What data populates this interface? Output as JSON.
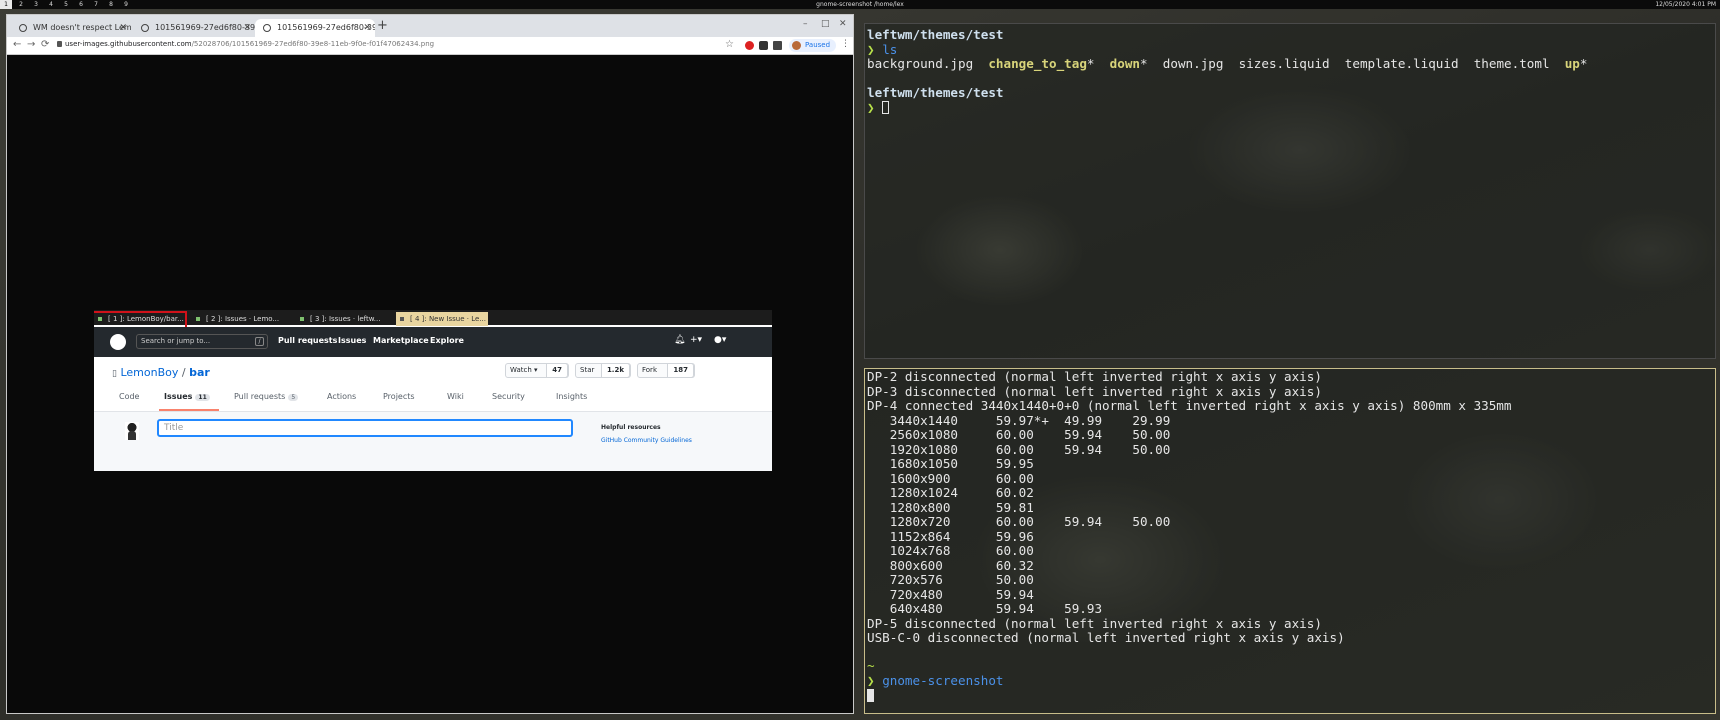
{
  "topbar": {
    "workspaces": [
      "1",
      "2",
      "3",
      "4",
      "5",
      "6",
      "7",
      "8",
      "9"
    ],
    "active_workspace": "1",
    "window_title": "gnome-screenshot /home/lex",
    "clock": "12/05/2020  4:01 PM"
  },
  "browser": {
    "tabs": [
      {
        "label": "WM doesn't respect Lem"
      },
      {
        "label": "101561969-27ed6f80-39e"
      },
      {
        "label": "101561969-27ed6f80-39e"
      }
    ],
    "new_tab": "+",
    "window_controls": [
      "–",
      "□",
      "✕"
    ],
    "url_host": "user-images.githubusercontent.com",
    "url_path": "/52028706/101561969-27ed6f80-39e8-11eb-9f0e-f01f47062434.png",
    "paused_label": "Paused",
    "nav": {
      "back": "←",
      "forward": "→",
      "reload": "⟳",
      "star": "☆",
      "menu": "⋮"
    }
  },
  "embedded": {
    "polybar_tabs": [
      {
        "label": "[ 1 ]: LemonBoy/bar..."
      },
      {
        "label": "[ 2 ]: Issues · Lemo..."
      },
      {
        "label": "[ 3 ]: Issues · leftw..."
      },
      {
        "label": "[ 4 ]: New Issue · Le..."
      }
    ],
    "gh_search_placeholder": "Search or jump to...",
    "gh_search_key": "/",
    "gh_nav": [
      "Pull requests",
      "Issues",
      "Marketplace",
      "Explore"
    ],
    "repo_owner": "LemonBoy",
    "repo_sep": "/",
    "repo_name": "bar",
    "watch": {
      "label": "Watch ▾",
      "count": "47"
    },
    "star": {
      "label": "Star",
      "count": "1.2k"
    },
    "fork": {
      "label": "Fork",
      "count": "187"
    },
    "repo_tabs": [
      {
        "label": "Code",
        "badge": ""
      },
      {
        "label": "Issues",
        "badge": "11"
      },
      {
        "label": "Pull requests",
        "badge": "5"
      },
      {
        "label": "Actions",
        "badge": ""
      },
      {
        "label": "Projects",
        "badge": ""
      },
      {
        "label": "Wiki",
        "badge": ""
      },
      {
        "label": "Security",
        "badge": ""
      },
      {
        "label": "Insights",
        "badge": ""
      }
    ],
    "title_placeholder": "Title",
    "helpful": "Helpful resources",
    "guidelines": "GitHub Community Guidelines"
  },
  "term1": {
    "cwd1": "leftwm/themes/test",
    "prompt": "❯",
    "cmd1": "ls",
    "ls_plain": [
      "background.jpg",
      "down.jpg",
      "sizes.liquid",
      "template.liquid",
      "theme.toml"
    ],
    "ls_exec": [
      "change_to_tag",
      "down",
      "up"
    ],
    "exec_mark": "*",
    "cwd2": "leftwm/themes/test"
  },
  "term2": {
    "lines": [
      "DP-2 disconnected (normal left inverted right x axis y axis)",
      "DP-3 disconnected (normal left inverted right x axis y axis)",
      "DP-4 connected 3440x1440+0+0 (normal left inverted right x axis y axis) 800mm x 335mm",
      "   3440x1440     59.97*+  49.99    29.99",
      "   2560x1080     60.00    59.94    50.00",
      "   1920x1080     60.00    59.94    50.00",
      "   1680x1050     59.95",
      "   1600x900      60.00",
      "   1280x1024     60.02",
      "   1280x800      59.81",
      "   1280x720      60.00    59.94    50.00",
      "   1152x864      59.96",
      "   1024x768      60.00",
      "   800x600       60.32",
      "   720x576       50.00",
      "   720x480       59.94",
      "   640x480       59.94    59.93",
      "DP-5 disconnected (normal left inverted right x axis y axis)",
      "USB-C-0 disconnected (normal left inverted right x axis y axis)"
    ],
    "home": "~",
    "prompt": "❯",
    "cmd": "gnome-screenshot"
  }
}
